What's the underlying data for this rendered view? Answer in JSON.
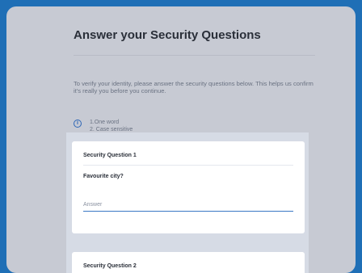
{
  "page": {
    "title": "Answer your Security Questions",
    "intro": "To verify your identity, please answer the security questions below. This helps us confirm it's really you before you continue.",
    "hint": {
      "icon": "info-icon",
      "lines": [
        "1.One word",
        "2. Case sensitive"
      ]
    }
  },
  "questions": [
    {
      "label": "Security Question 1",
      "question": "Favourite city?",
      "placeholder": "Answer",
      "value": ""
    },
    {
      "label": "Security Question 2"
    }
  ],
  "colors": {
    "outer_blue": "#1f6fb6",
    "panel": "#c7cad3",
    "section_bg": "#d6dbe5",
    "card": "#ffffff",
    "accent": "#3a78c5"
  }
}
